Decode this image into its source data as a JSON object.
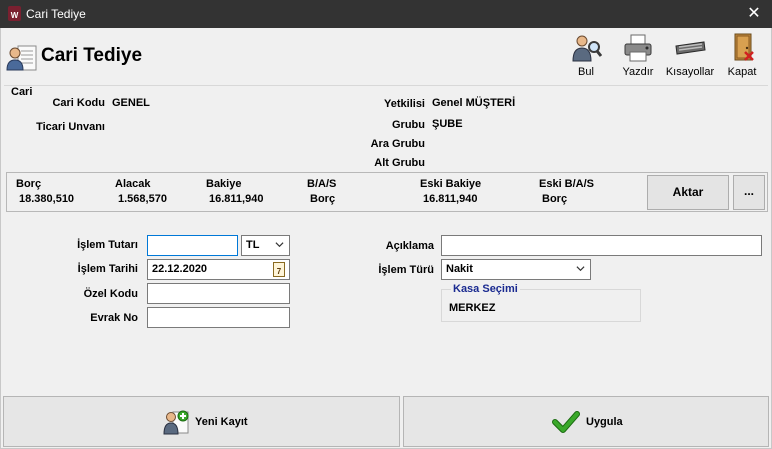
{
  "window": {
    "title": "Cari Tediye",
    "app_icon_text": "W"
  },
  "header": {
    "title": "Cari Tediye"
  },
  "toolbar": {
    "bul": "Bul",
    "yazdir": "Yazdır",
    "kisayollar": "Kısayollar",
    "kapat": "Kapat"
  },
  "cari": {
    "section_label": "Cari",
    "kodu_label": "Cari Kodu",
    "kodu_value": "GENEL",
    "unvan_label": "Ticari Unvanı",
    "unvan_value": "",
    "yetkili_label": "Yetkilisi",
    "yetkili_value": "Genel MÜŞTERİ",
    "grubu_label": "Grubu",
    "grubu_value": "ŞUBE",
    "ara_grubu_label": "Ara Grubu",
    "ara_grubu_value": "",
    "alt_grubu_label": "Alt Grubu",
    "alt_grubu_value": ""
  },
  "balance": {
    "borc_label": "Borç",
    "borc_value": "18.380,510",
    "alacak_label": "Alacak",
    "alacak_value": "1.568,570",
    "bakiye_label": "Bakiye",
    "bakiye_value": "16.811,940",
    "bas_label": "B/A/S",
    "bas_value": "Borç",
    "eski_bakiye_label": "Eski Bakiye",
    "eski_bakiye_value": "16.811,940",
    "eski_bas_label": "Eski B/A/S",
    "eski_bas_value": "Borç",
    "aktar_label": "Aktar",
    "more_label": "..."
  },
  "form": {
    "islem_tutari_label": "İşlem Tutarı",
    "islem_tutari_value": "",
    "currency_value": "TL",
    "islem_tarihi_label": "İşlem Tarihi",
    "islem_tarihi_value": "22.12.2020",
    "calendar_day": "7",
    "ozel_kodu_label": "Özel Kodu",
    "ozel_kodu_value": "",
    "evrak_no_label": "Evrak No",
    "evrak_no_value": "",
    "aciklama_label": "Açıklama",
    "aciklama_value": "",
    "islem_turu_label": "İşlem Türü",
    "islem_turu_value": "Nakit",
    "kasa_title": "Kasa Seçimi",
    "kasa_value": "MERKEZ"
  },
  "actions": {
    "yeni_kayit": "Yeni Kayıt",
    "uygula": "Uygula"
  },
  "colors": {
    "titlebar": "#333333",
    "background": "#f0f0f0",
    "kasa_title": "#1a2a90",
    "check_green": "#3aa82a"
  }
}
